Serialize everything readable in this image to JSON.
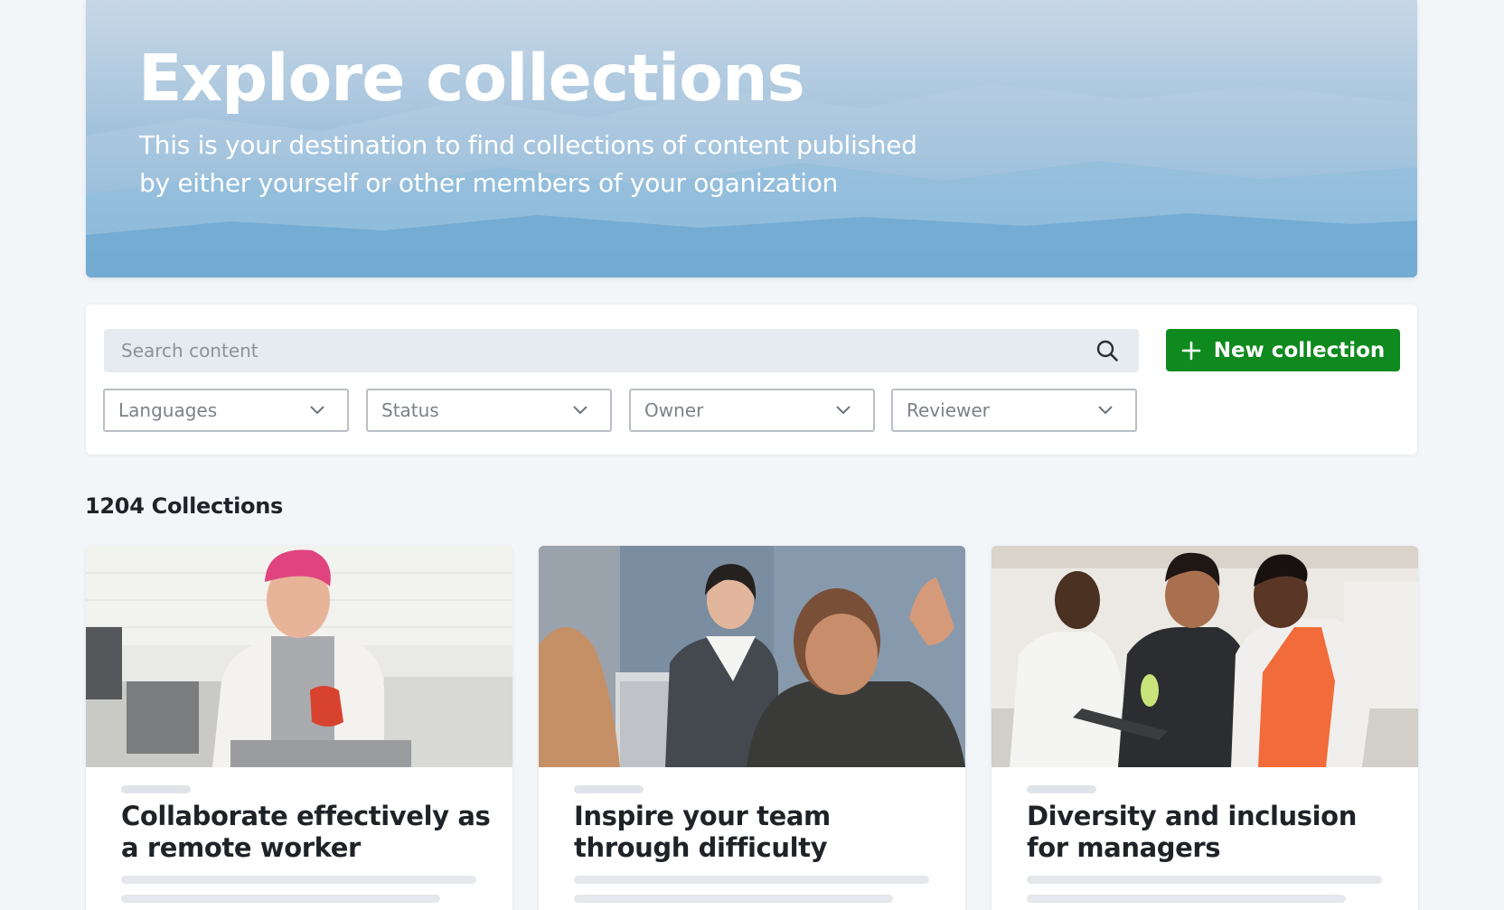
{
  "hero": {
    "title": "Explore collections",
    "subtitle_line1": "This is your destination to find collections of content published",
    "subtitle_line2": "by either yourself or other members of your oganization"
  },
  "search": {
    "placeholder": "Search content",
    "icon": "search-icon"
  },
  "new_collection": {
    "label": "New collection",
    "icon": "plus-icon",
    "color": "#0f8a1e"
  },
  "filters": [
    {
      "label": "Languages",
      "icon": "chevron-down-icon"
    },
    {
      "label": "Status",
      "icon": "chevron-down-icon"
    },
    {
      "label": "Owner",
      "icon": "chevron-down-icon"
    },
    {
      "label": "Reviewer",
      "icon": "chevron-down-icon"
    }
  ],
  "results": {
    "count_label": "1204 Collections"
  },
  "cards": [
    {
      "title": "Collaborate effectively as a remote worker",
      "image": "woman-with-mug-in-kitchen"
    },
    {
      "title": "Inspire your team through difficulty",
      "image": "speaker-presenting-to-audience"
    },
    {
      "title": "Diversity and inclusion for managers",
      "image": "team-cooking-with-tablet"
    }
  ]
}
